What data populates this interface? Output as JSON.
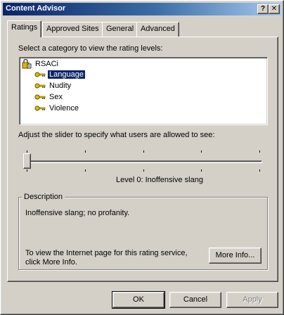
{
  "window": {
    "title": "Content Advisor",
    "help_button": "?",
    "close_button": "✕"
  },
  "tabs": [
    {
      "label": "Ratings",
      "active": true
    },
    {
      "label": "Approved Sites",
      "active": false
    },
    {
      "label": "General",
      "active": false
    },
    {
      "label": "Advanced",
      "active": false
    }
  ],
  "ratings": {
    "category_prompt": "Select a category to view the rating levels:",
    "tree": {
      "root": "RSACi",
      "items": [
        {
          "label": "Language",
          "selected": true
        },
        {
          "label": "Nudity",
          "selected": false
        },
        {
          "label": "Sex",
          "selected": false
        },
        {
          "label": "Violence",
          "selected": false
        }
      ]
    },
    "slider_prompt": "Adjust the slider to specify what users are allowed to see:",
    "slider": {
      "level": 0,
      "max_level": 4
    },
    "level_text": "Level 0:  Inoffensive slang",
    "description": {
      "title": "Description",
      "text": "Inoffensive slang; no profanity.",
      "service_text_line1": "To view the Internet page for this rating service,",
      "service_text_line2": "click More Info.",
      "more_info_button": "More Info..."
    }
  },
  "footer": {
    "ok": "OK",
    "cancel": "Cancel",
    "apply": "Apply"
  },
  "colors": {
    "title_gradient_start": "#0a246a",
    "title_gradient_end": "#a6caf0",
    "face": "#d4d0c8",
    "selection": "#0a246a"
  }
}
